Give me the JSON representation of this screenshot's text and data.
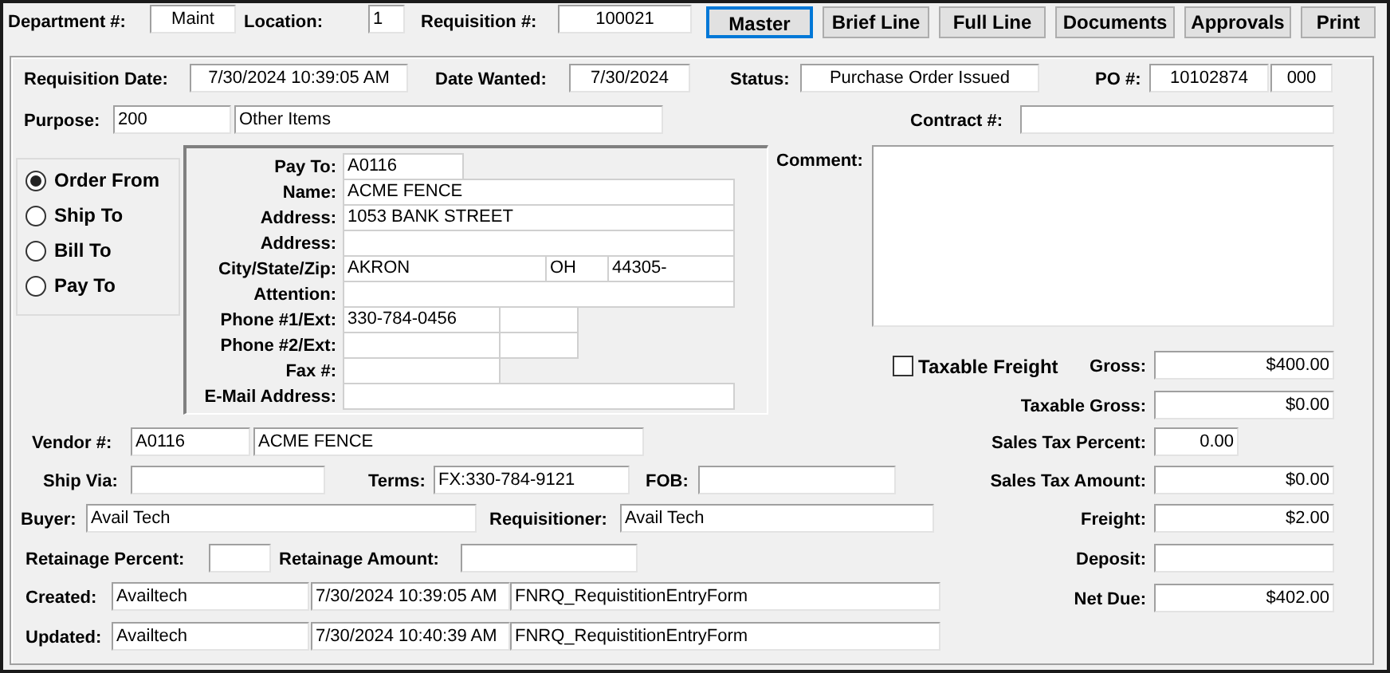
{
  "header": [
    {
      "label": "Department #:",
      "value": "Maint"
    },
    {
      "label": "Location:",
      "value": "1"
    },
    {
      "label": "Requisition #:",
      "value": "100021"
    }
  ],
  "toolbar": [
    {
      "label": "Master",
      "selected": true
    },
    {
      "label": "Brief Line",
      "selected": false
    },
    {
      "label": "Full Line",
      "selected": false
    },
    {
      "label": "Documents",
      "selected": false
    },
    {
      "label": "Approvals",
      "selected": false
    },
    {
      "label": "Print",
      "selected": false
    }
  ],
  "details": [
    [
      {
        "label": "Requisition Date:",
        "value": "7/30/2024 10:39:05 AM"
      },
      {
        "label": "Date Wanted:",
        "value": "7/30/2024"
      },
      {
        "label": "Status:",
        "value": "Purchase Order Issued"
      },
      {
        "label": "PO #:",
        "value": "10102874"
      },
      {
        "value": "000"
      }
    ],
    [
      {
        "label": "Purpose:",
        "value": "200"
      },
      {
        "value": "Other Items"
      },
      {
        "label": "Contract #:"
      }
    ]
  ],
  "address_options": [
    {
      "label": "Order From",
      "selected": true
    },
    {
      "label": "Ship To",
      "selected": false
    },
    {
      "label": "Bill To",
      "selected": false
    },
    {
      "label": "Pay To",
      "selected": false
    }
  ],
  "address": [
    {
      "kind": "short",
      "label": "Pay To:",
      "value": "A0116"
    },
    {
      "kind": "wide",
      "label": "Name:",
      "value": "ACME FENCE"
    },
    {
      "kind": "wide",
      "label": "Address:",
      "value": "1053 BANK STREET"
    },
    {
      "kind": "wide",
      "label": "Address:"
    },
    {
      "kind": "city",
      "label": "City/State/Zip:",
      "value": "AKRON",
      "state": "OH",
      "zip": "44305-"
    },
    {
      "kind": "wide",
      "label": "Attention:"
    },
    {
      "kind": "phone",
      "label": "Phone #1/Ext:",
      "value": "330-784-0456"
    },
    {
      "kind": "phone",
      "label": "Phone #2/Ext:"
    },
    {
      "kind": "fax",
      "label": "Fax #:"
    },
    {
      "kind": "wide",
      "label": "E-Mail Address:"
    }
  ],
  "comment": {
    "label": "Comment:"
  },
  "taxable_freight": {
    "label": "Taxable Freight",
    "checked": false
  },
  "totals": [
    {
      "kind": "amount",
      "label": "Gross:",
      "value": "$400.00"
    },
    {
      "kind": "amount",
      "label": "Taxable Gross:",
      "value": "$0.00"
    },
    {
      "kind": "short",
      "label": "Sales Tax Percent:",
      "value": "0.00"
    },
    {
      "kind": "amount",
      "label": "Sales Tax Amount:",
      "value": "$0.00"
    },
    {
      "kind": "amount",
      "label": "Freight:",
      "value": "$2.00"
    },
    {
      "kind": "amount",
      "label": "Deposit:"
    },
    {
      "kind": "amount",
      "label": "Net Due:",
      "value": "$402.00"
    }
  ],
  "lower_fields": [
    [
      {
        "label": "Vendor #:",
        "value": "A0116"
      },
      {
        "value": "ACME FENCE"
      }
    ],
    [
      {
        "label": "Ship Via:"
      },
      {
        "label": "Terms:",
        "value": "FX:330-784-9121"
      },
      {
        "label": "FOB:"
      }
    ],
    [
      {
        "label": "Buyer:",
        "value": "Avail Tech"
      },
      {
        "label": "Requisitioner:",
        "value": "Avail Tech"
      }
    ],
    [
      {
        "label": "Retainage Percent:"
      },
      {
        "label": "Retainage Amount:"
      }
    ],
    [
      {
        "label": "Created:",
        "value": "Availtech"
      },
      {
        "value": "7/30/2024 10:39:05 AM"
      },
      {
        "value": "FNRQ_RequistitionEntryForm"
      }
    ],
    [
      {
        "label": "Updated:",
        "value": "Availtech"
      },
      {
        "value": "7/30/2024 10:40:39 AM"
      },
      {
        "value": "FNRQ_RequistitionEntryForm"
      }
    ]
  ]
}
